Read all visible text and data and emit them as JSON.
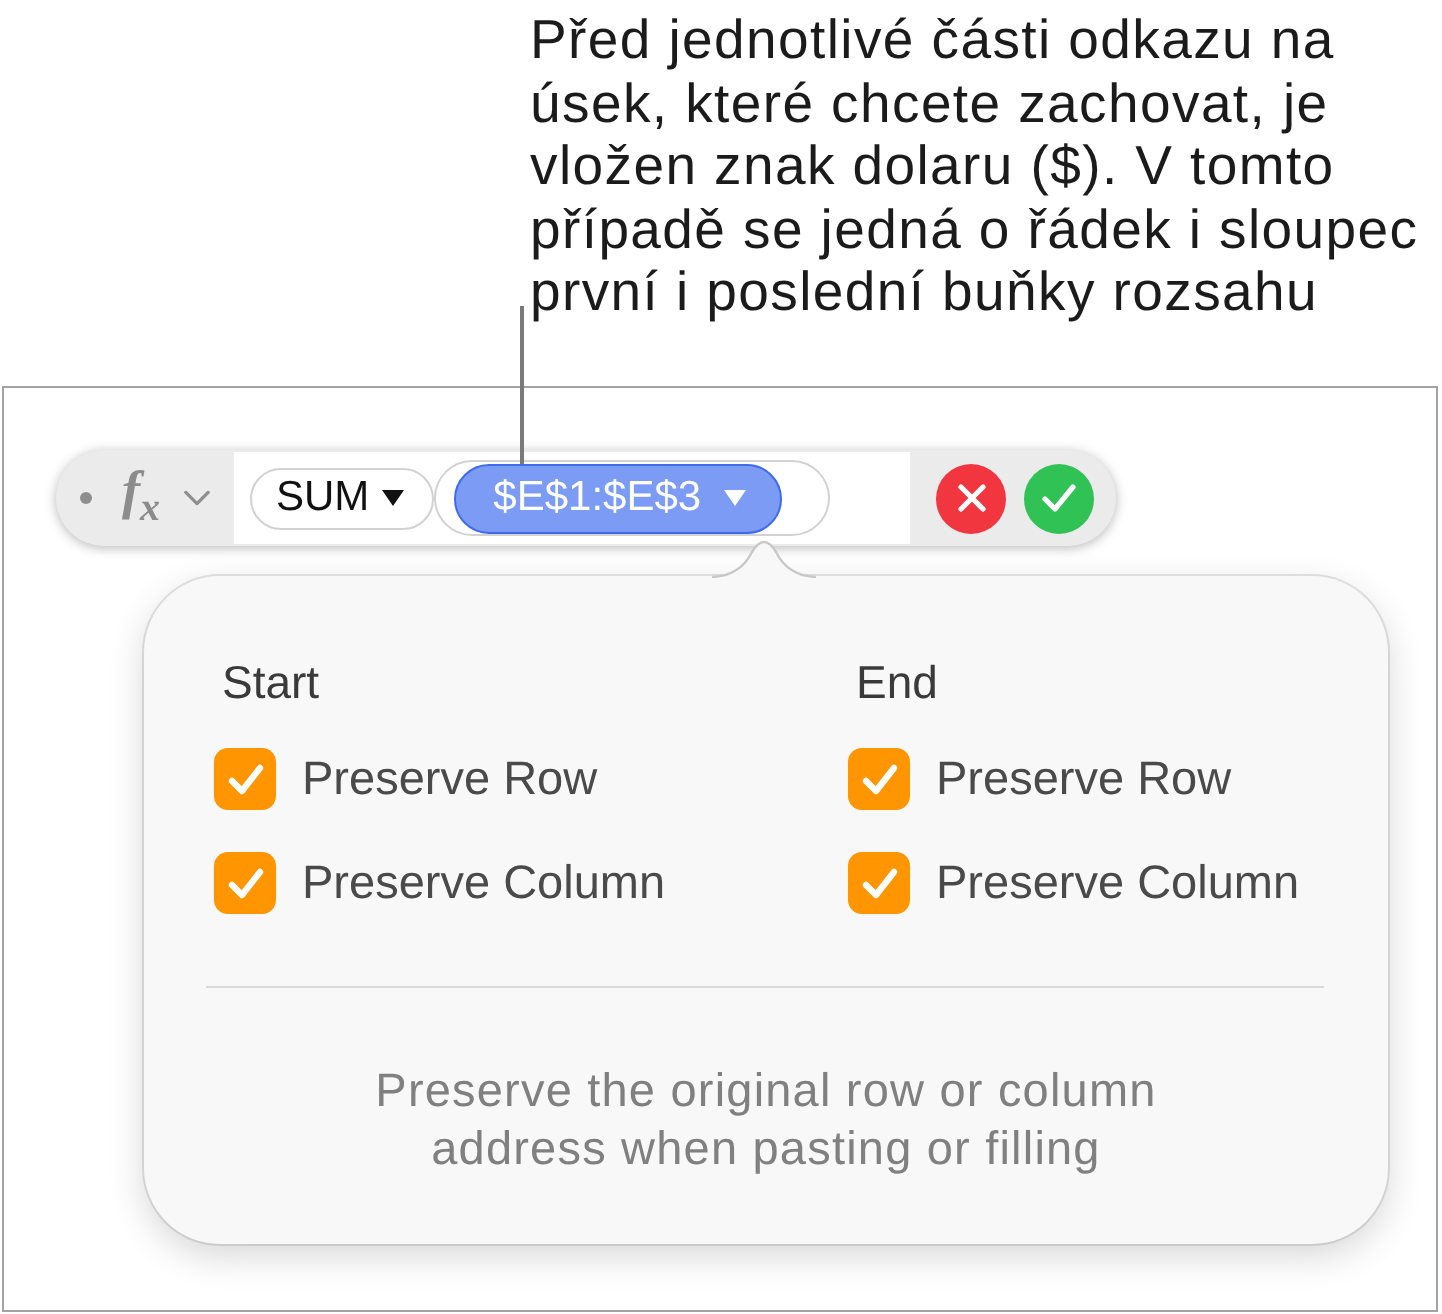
{
  "annotation": {
    "lines": [
      "Před jednotlivé části odkazu na",
      "úsek, které chcete zachovat, je",
      "vložen znak dolaru ($). V tomto",
      "případě se jedná o řádek i sloupec",
      "první i poslední buňky rozsahu"
    ]
  },
  "formula_bar": {
    "function_symbol": "f$_{x}$",
    "tokens": [
      {
        "kind": "function",
        "label": "SUM",
        "selected": false
      },
      {
        "kind": "range",
        "label": "$E$1:$E$3",
        "selected": true
      }
    ]
  },
  "popover": {
    "columns": [
      {
        "heading": "Start",
        "options": [
          {
            "label": "Preserve Row",
            "checked": true
          },
          {
            "label": "Preserve Column",
            "checked": true
          }
        ]
      },
      {
        "heading": "End",
        "options": [
          {
            "label": "Preserve Row",
            "checked": true
          },
          {
            "label": "Preserve Column",
            "checked": true
          }
        ]
      }
    ],
    "description_lines": [
      "Preserve the original row or column",
      "address when pasting or filling"
    ]
  }
}
